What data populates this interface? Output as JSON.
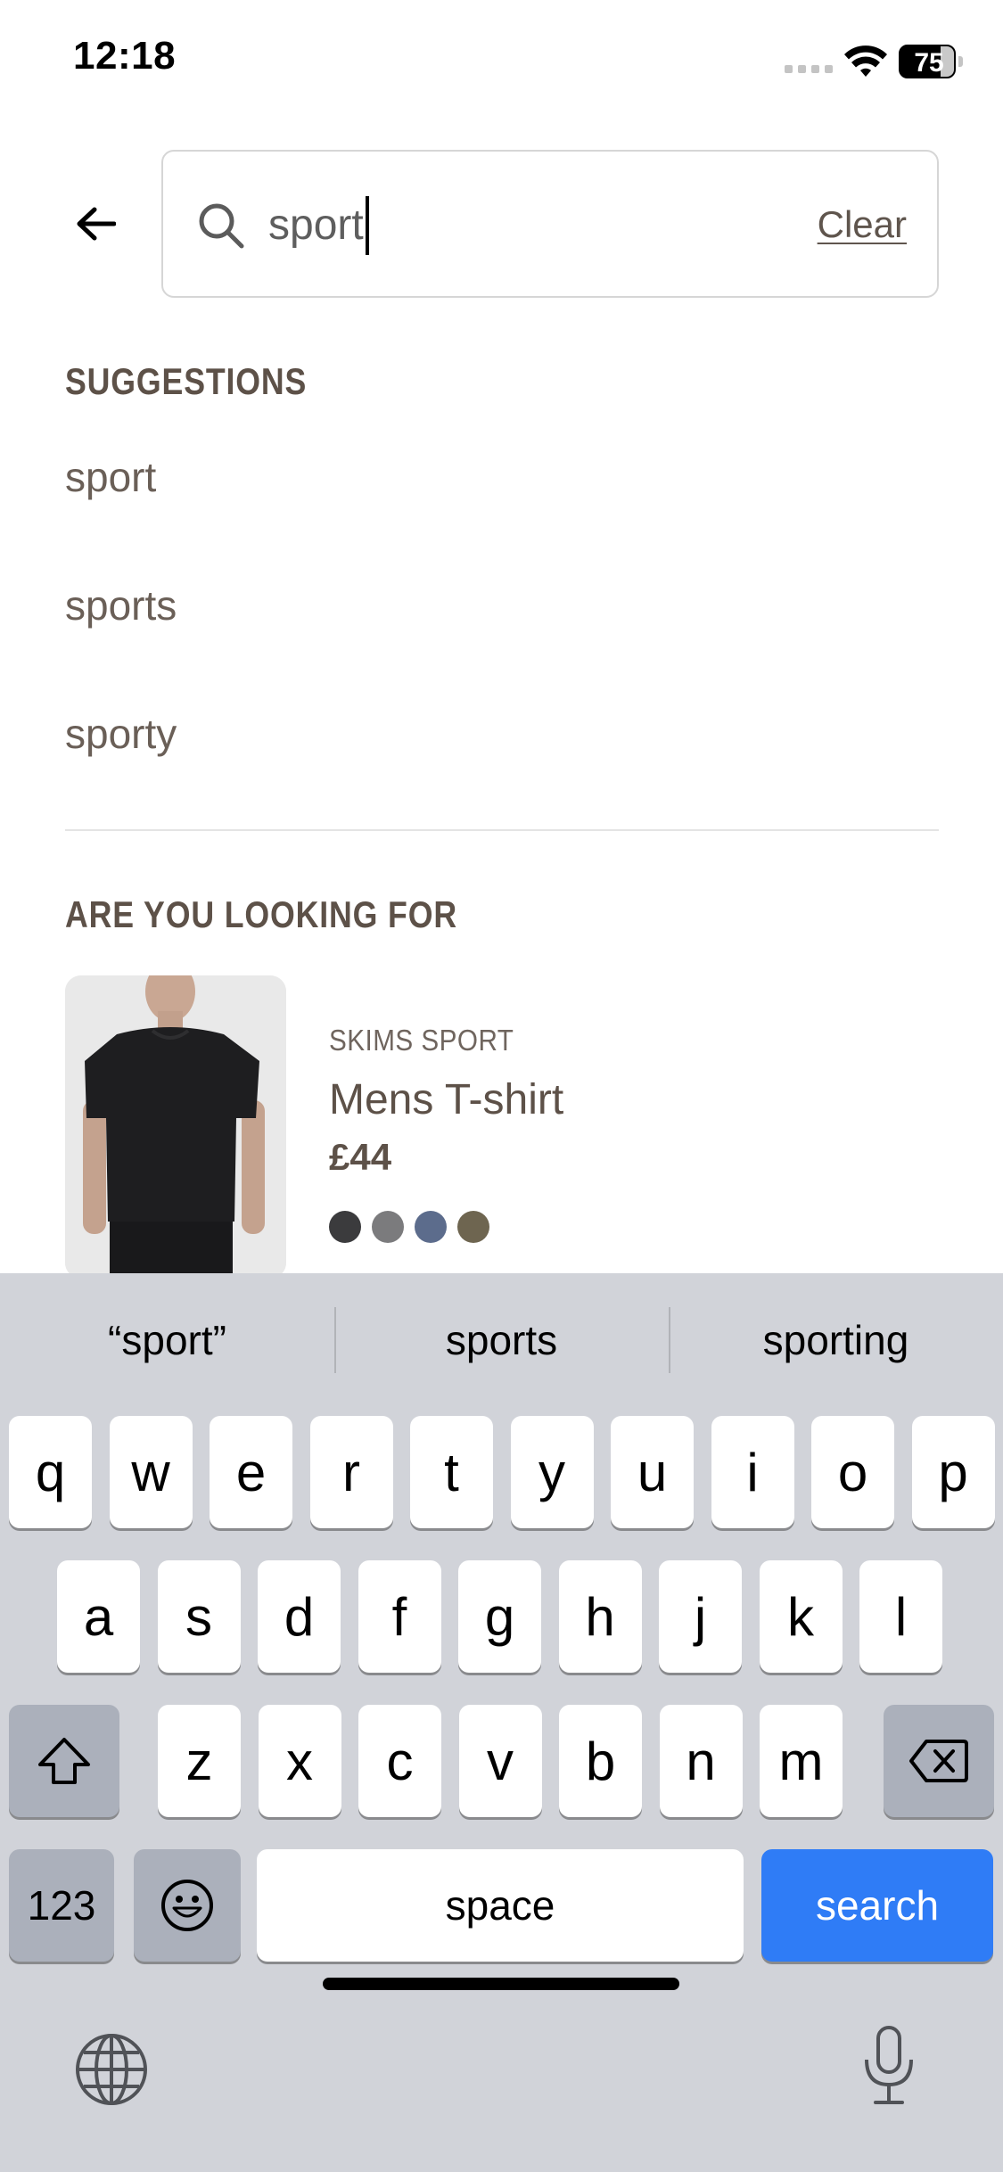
{
  "status_bar": {
    "time": "12:18",
    "battery": "75",
    "battery_level_percent": 75
  },
  "search": {
    "query": "sport",
    "clear_label": "Clear"
  },
  "suggestions": {
    "heading": "SUGGESTIONS",
    "items": [
      "sport",
      "sports",
      "sporty"
    ]
  },
  "looking_for": {
    "heading": "ARE YOU LOOKING FOR",
    "product": {
      "brand": "SKIMS SPORT",
      "name": "Mens T-shirt",
      "price": "£44",
      "swatches": [
        "#3b3b3d",
        "#7b7b7d",
        "#5c6c8c",
        "#6e6550"
      ]
    }
  },
  "keyboard": {
    "predictions": [
      "“sport”",
      "sports",
      "sporting"
    ],
    "row1": [
      "q",
      "w",
      "e",
      "r",
      "t",
      "y",
      "u",
      "i",
      "o",
      "p"
    ],
    "row2": [
      "a",
      "s",
      "d",
      "f",
      "g",
      "h",
      "j",
      "k",
      "l"
    ],
    "row3": [
      "z",
      "x",
      "c",
      "v",
      "b",
      "n",
      "m"
    ],
    "numbers_label": "123",
    "space_label": "space",
    "search_label": "search",
    "accent_color": "#2f7cf6"
  }
}
